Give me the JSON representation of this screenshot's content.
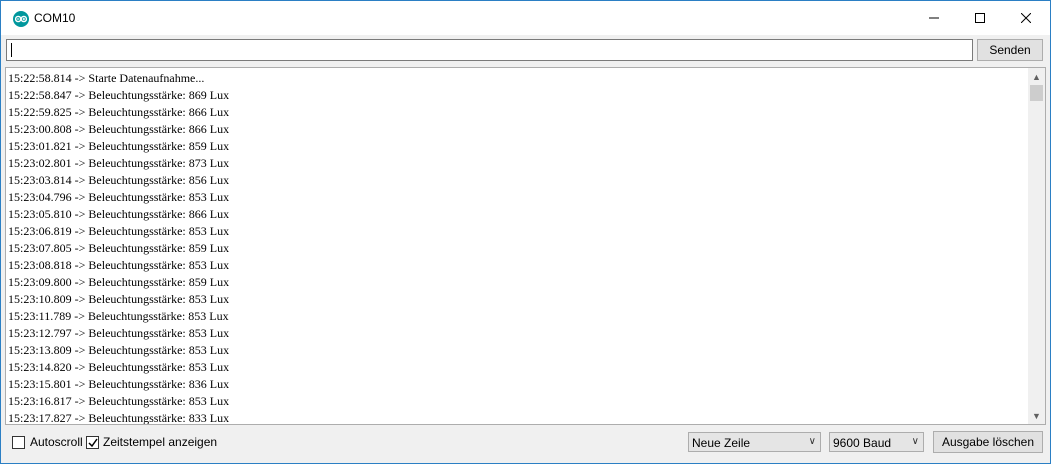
{
  "window": {
    "title": "COM10",
    "icon": "arduino-icon",
    "controls": {
      "minimize": "minimize-icon",
      "maximize": "maximize-icon",
      "close": "close-icon"
    }
  },
  "send": {
    "input_value": "",
    "button_label": "Senden"
  },
  "output": {
    "lines": [
      "15:22:58.814 -> Starte Datenaufnahme...",
      "15:22:58.847 -> Beleuchtungsstärke: 869 Lux",
      "15:22:59.825 -> Beleuchtungsstärke: 866 Lux",
      "15:23:00.808 -> Beleuchtungsstärke: 866 Lux",
      "15:23:01.821 -> Beleuchtungsstärke: 859 Lux",
      "15:23:02.801 -> Beleuchtungsstärke: 873 Lux",
      "15:23:03.814 -> Beleuchtungsstärke: 856 Lux",
      "15:23:04.796 -> Beleuchtungsstärke: 853 Lux",
      "15:23:05.810 -> Beleuchtungsstärke: 866 Lux",
      "15:23:06.819 -> Beleuchtungsstärke: 853 Lux",
      "15:23:07.805 -> Beleuchtungsstärke: 859 Lux",
      "15:23:08.818 -> Beleuchtungsstärke: 853 Lux",
      "15:23:09.800 -> Beleuchtungsstärke: 859 Lux",
      "15:23:10.809 -> Beleuchtungsstärke: 853 Lux",
      "15:23:11.789 -> Beleuchtungsstärke: 853 Lux",
      "15:23:12.797 -> Beleuchtungsstärke: 853 Lux",
      "15:23:13.809 -> Beleuchtungsstärke: 853 Lux",
      "15:23:14.820 -> Beleuchtungsstärke: 853 Lux",
      "15:23:15.801 -> Beleuchtungsstärke: 836 Lux",
      "15:23:16.817 -> Beleuchtungsstärke: 853 Lux",
      "15:23:17.827 -> Beleuchtungsstärke: 833 Lux"
    ]
  },
  "footer": {
    "autoscroll": {
      "label": "Autoscroll",
      "checked": false
    },
    "timestamp": {
      "label": "Zeitstempel anzeigen",
      "checked": true
    },
    "line_ending": {
      "selected": "Neue Zeile"
    },
    "baud": {
      "selected": "9600 Baud"
    },
    "clear_label": "Ausgabe löschen"
  },
  "colors": {
    "window_border": "#2b7fc4",
    "icon_teal": "#00979d",
    "button_face": "#e1e1e1"
  }
}
